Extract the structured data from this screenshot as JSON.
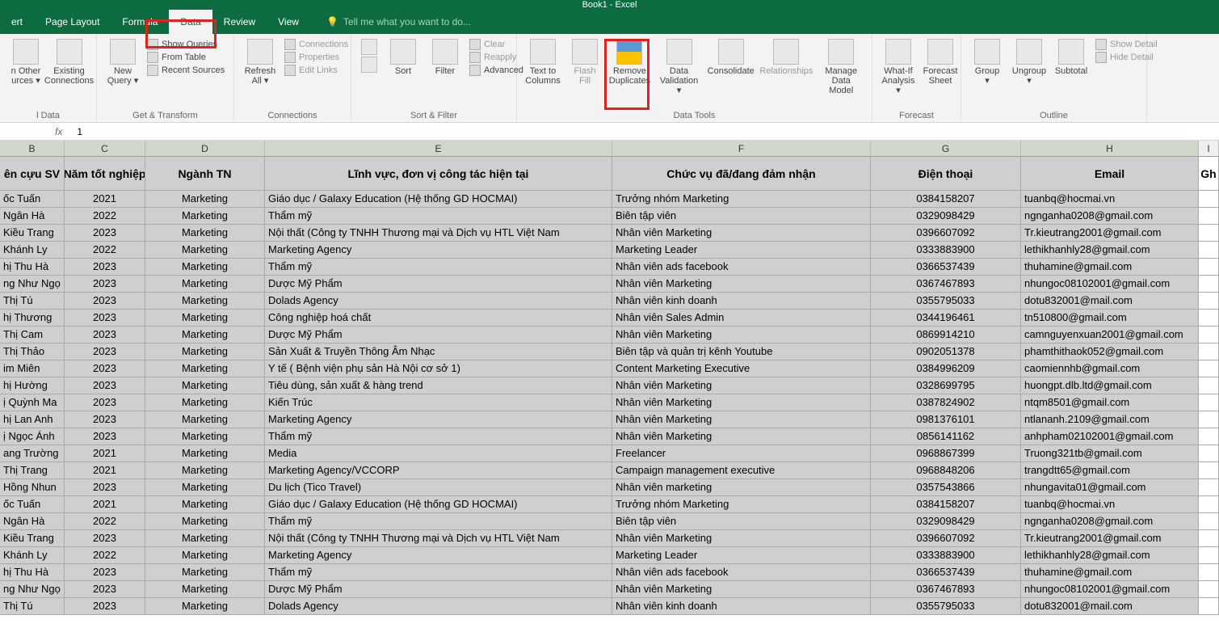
{
  "title": "Book1 - Excel",
  "menu": {
    "items": [
      "ert",
      "Page Layout",
      "Formula",
      "Data",
      "Review",
      "View"
    ],
    "active": 3,
    "tellme": "Tell me what you want to do..."
  },
  "ribbon": {
    "externalData": {
      "fromOther": "n Other\nurces ▾",
      "existing": "Existing\nConnections",
      "label": "l Data"
    },
    "getTransform": {
      "newQuery": "New\nQuery ▾",
      "showQueries": "Show Queries",
      "fromTable": "From Table",
      "recentSources": "Recent Sources",
      "label": "Get & Transform"
    },
    "connections": {
      "refreshAll": "Refresh\nAll ▾",
      "connections": "Connections",
      "properties": "Properties",
      "editLinks": "Edit Links",
      "label": "Connections"
    },
    "sortFilter": {
      "sort": "Sort",
      "filter": "Filter",
      "clear": "Clear",
      "reapply": "Reapply",
      "advanced": "Advanced",
      "label": "Sort & Filter"
    },
    "dataTools": {
      "textToColumns": "Text to\nColumns",
      "flashFill": "Flash\nFill",
      "removeDup": "Remove\nDuplicates",
      "dataValidation": "Data\nValidation ▾",
      "consolidate": "Consolidate",
      "relationships": "Relationships",
      "manageModel": "Manage\nData Model",
      "label": "Data Tools"
    },
    "forecast": {
      "whatIf": "What-If\nAnalysis ▾",
      "forecastSheet": "Forecast\nSheet",
      "label": "Forecast"
    },
    "outline": {
      "group": "Group\n▾",
      "ungroup": "Ungroup\n▾",
      "subtotal": "Subtotal",
      "showDetail": "Show Detail",
      "hideDetail": "Hide Detail",
      "label": "Outline"
    }
  },
  "formula": {
    "fx": "fx",
    "value": "1"
  },
  "columns": [
    "B",
    "C",
    "D",
    "E",
    "F",
    "G",
    "H",
    "I"
  ],
  "headers": {
    "B": "ên cựu SV",
    "C": "Năm tốt nghiệp",
    "D": "Ngành TN",
    "E": "Lĩnh vực, đơn vị công tác hiện tại",
    "F": "Chức vụ đã/đang đảm nhận",
    "G": "Điện thoại",
    "H": "Email",
    "I": "Gh"
  },
  "rows": [
    {
      "B": "ốc Tuấn",
      "C": "2021",
      "D": "Marketing",
      "E": "Giáo dục / Galaxy Education (Hệ thống GD HOCMAI)",
      "F": "Trưởng nhóm Marketing",
      "G": "0384158207",
      "H": "tuanbq@hocmai.vn"
    },
    {
      "B": "Ngân Hà",
      "C": "2022",
      "D": "Marketing",
      "E": "Thẩm mỹ",
      "F": "Biên tập viên",
      "G": "0329098429",
      "H": "ngnganha0208@gmail.com"
    },
    {
      "B": "Kiều Trang",
      "C": "2023",
      "D": "Marketing",
      "E": "Nội thất (Công ty TNHH Thương mại và Dịch vụ HTL Việt Nam",
      "F": "Nhân viên Marketing",
      "G": "0396607092",
      "H": "Tr.kieutrang2001@gmail.com"
    },
    {
      "B": "Khánh Ly",
      "C": "2022",
      "D": "Marketing",
      "E": "Marketing Agency",
      "F": "Marketing Leader",
      "G": "0333883900",
      "H": "lethikhanhly28@gmail.com"
    },
    {
      "B": "hị Thu Hà",
      "C": "2023",
      "D": "Marketing",
      "E": "Thẩm mỹ",
      "F": "Nhân viên ads facebook",
      "G": "0366537439",
      "H": "thuhamine@gmail.com"
    },
    {
      "B": "ng Như Ngọ",
      "C": "2023",
      "D": "Marketing",
      "E": "Dược Mỹ Phẩm",
      "F": "Nhân viên Marketing",
      "G": "0367467893",
      "H": "nhungoc08102001@gmail.com"
    },
    {
      "B": "Thị Tú",
      "C": "2023",
      "D": "Marketing",
      "E": "Dolads Agency",
      "F": "Nhân viên kinh doanh",
      "G": "0355795033",
      "H": "dotu832001@mail.com"
    },
    {
      "B": "hị Thương",
      "C": "2023",
      "D": "Marketing",
      "E": "Công nghiệp hoá chất",
      "F": "Nhân viên Sales Admin",
      "G": "0344196461",
      "H": "tn510800@gmail.com"
    },
    {
      "B": "Thị Cam",
      "C": "2023",
      "D": "Marketing",
      "E": "Dược Mỹ Phẩm",
      "F": "Nhân viên Marketing",
      "G": "0869914210",
      "H": "camnguyenxuan2001@gmail.com"
    },
    {
      "B": "Thị Thảo",
      "C": "2023",
      "D": "Marketing",
      "E": "Sản Xuất & Truyền Thông Âm Nhạc",
      "F": "Biên tập và quản trị kênh Youtube",
      "G": "0902051378",
      "H": "phamthithaok052@gmail.com"
    },
    {
      "B": "im Miên",
      "C": "2023",
      "D": "Marketing",
      "E": "Y tế ( Bệnh viện phụ sản Hà Nội cơ sở 1)",
      "F": "Content Marketing Executive",
      "G": "0384996209",
      "H": "caomiennhb@gmail.com"
    },
    {
      "B": "hị Hường",
      "C": "2023",
      "D": "Marketing",
      "E": "Tiêu dùng, sản xuất & hàng trend",
      "F": "Nhân viên Marketing",
      "G": "0328699795",
      "H": "huongpt.dlb.ltd@gmail.com"
    },
    {
      "B": "ị Quỳnh Ma",
      "C": "2023",
      "D": "Marketing",
      "E": "Kiến Trúc",
      "F": "Nhân viên Marketing",
      "G": "0387824902",
      "H": "ntqm8501@gmail.com"
    },
    {
      "B": "hị Lan Anh",
      "C": "2023",
      "D": "Marketing",
      "E": "Marketing Agency",
      "F": "Nhân viên Marketing",
      "G": "0981376101",
      "H": "ntlananh.2109@gmail.com"
    },
    {
      "B": "ị Ngọc Ánh",
      "C": "2023",
      "D": "Marketing",
      "E": "Thẩm mỹ",
      "F": "Nhân viên Marketing",
      "G": "0856141162",
      "H": "anhpham02102001@gmail.com"
    },
    {
      "B": "ang Trường",
      "C": "2021",
      "D": "Marketing",
      "E": "Media",
      "F": "Freelancer",
      "G": "0968867399",
      "H": "Truong321tb@gmail.com"
    },
    {
      "B": "Thị Trang",
      "C": "2021",
      "D": "Marketing",
      "E": "Marketing Agency/VCCORP",
      "F": "Campaign management executive",
      "G": "0968848206",
      "H": "trangdtt65@gmail.com"
    },
    {
      "B": "Hồng Nhun",
      "C": "2023",
      "D": "Marketing",
      "E": "Du lịch (Tico Travel)",
      "F": "Nhân viên marketing",
      "G": "0357543866",
      "H": "nhungavita01@gmail.com"
    },
    {
      "B": "ốc Tuấn",
      "C": "2021",
      "D": "Marketing",
      "E": "Giáo dục / Galaxy Education (Hệ thống GD HOCMAI)",
      "F": "Trưởng nhóm Marketing",
      "G": "0384158207",
      "H": "tuanbq@hocmai.vn"
    },
    {
      "B": "Ngân Hà",
      "C": "2022",
      "D": "Marketing",
      "E": "Thẩm mỹ",
      "F": "Biên tập viên",
      "G": "0329098429",
      "H": "ngnganha0208@gmail.com"
    },
    {
      "B": "Kiều Trang",
      "C": "2023",
      "D": "Marketing",
      "E": "Nội thất (Công ty TNHH Thương mại và Dịch vụ HTL Việt Nam",
      "F": "Nhân viên Marketing",
      "G": "0396607092",
      "H": "Tr.kieutrang2001@gmail.com"
    },
    {
      "B": "Khánh Ly",
      "C": "2022",
      "D": "Marketing",
      "E": "Marketing Agency",
      "F": "Marketing Leader",
      "G": "0333883900",
      "H": "lethikhanhly28@gmail.com"
    },
    {
      "B": "hị Thu Hà",
      "C": "2023",
      "D": "Marketing",
      "E": "Thẩm mỹ",
      "F": "Nhân viên ads facebook",
      "G": "0366537439",
      "H": "thuhamine@gmail.com"
    },
    {
      "B": "ng Như Ngọ",
      "C": "2023",
      "D": "Marketing",
      "E": "Dược Mỹ Phẩm",
      "F": "Nhân viên Marketing",
      "G": "0367467893",
      "H": "nhungoc08102001@gmail.com"
    },
    {
      "B": "Thị Tú",
      "C": "2023",
      "D": "Marketing",
      "E": "Dolads Agency",
      "F": "Nhân viên kinh doanh",
      "G": "0355795033",
      "H": "dotu832001@mail.com"
    }
  ]
}
